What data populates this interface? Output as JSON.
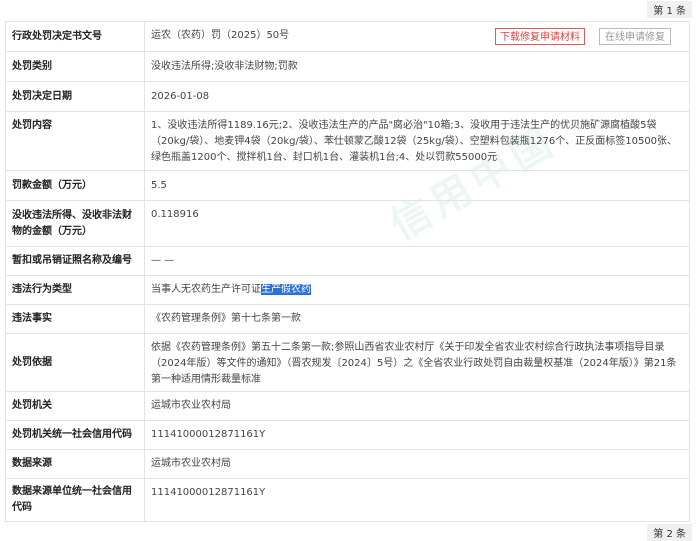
{
  "pagination": {
    "top_label": "第 1 条",
    "bottom_label": "第 2 条"
  },
  "watermark_text": "信用中国",
  "actions": {
    "download_label": "下载修复申请材料",
    "online_label": "在线申请修复"
  },
  "record": {
    "doc_number": {
      "label": "行政处罚决定书文号",
      "value": "运农（农药）罚（2025）50号"
    },
    "penalty_type": {
      "label": "处罚类别",
      "value": "没收违法所得;没收非法财物;罚款"
    },
    "decision_date": {
      "label": "处罚决定日期",
      "value": "2026-01-08"
    },
    "content": {
      "label": "处罚内容",
      "value": "1、没收违法所得1189.16元;2、没收违法生产的产品\"腐必治\"10箱;3、没收用于违法生产的优贝施矿源腐植酸5袋（20kg/袋）、地麦钾4袋（20kg/袋）、苯仕顿蒙乙酸12袋（25kg/袋）、空塑料包装瓶1276个、正反面标签10500张、绿色瓶盖1200个、搅拌机1台、封口机1台、灌装机1台;4、处以罚款55000元"
    },
    "fine_amount": {
      "label": "罚款金额（万元）",
      "value": "5.5"
    },
    "confiscated_amount": {
      "label": "没收违法所得、没收非法财物的金额（万元）",
      "value": "0.118916"
    },
    "license_revoked": {
      "label": "暂扣或吊销证照名称及编号",
      "value": "— —"
    },
    "violation_type": {
      "label": "违法行为类型",
      "value_prefix": "当事人无农药生产许可证",
      "value_highlight": "生产假农药"
    },
    "violation_facts": {
      "label": "违法事实",
      "value": "《农药管理条例》第十七条第一款"
    },
    "basis": {
      "label": "处罚依据",
      "value": "依据《农药管理条例》第五十二条第一款;参照山西省农业农村厅《关于印发全省农业农村综合行政执法事项指导目录（2024年版）等文件的通知》（晋农规发〔2024〕5号）之《全省农业行政处罚自由裁量权基准（2024年版）》第21条第一种适用情形裁量标准"
    },
    "authority": {
      "label": "处罚机关",
      "value": "运城市农业农村局"
    },
    "authority_code": {
      "label": "处罚机关统一社会信用代码",
      "value": "11141000012871161Y"
    },
    "data_source": {
      "label": "数据来源",
      "value": "运城市农业农村局"
    },
    "source_code": {
      "label": "数据来源单位统一社会信用代码",
      "value": "11141000012871161Y"
    }
  }
}
